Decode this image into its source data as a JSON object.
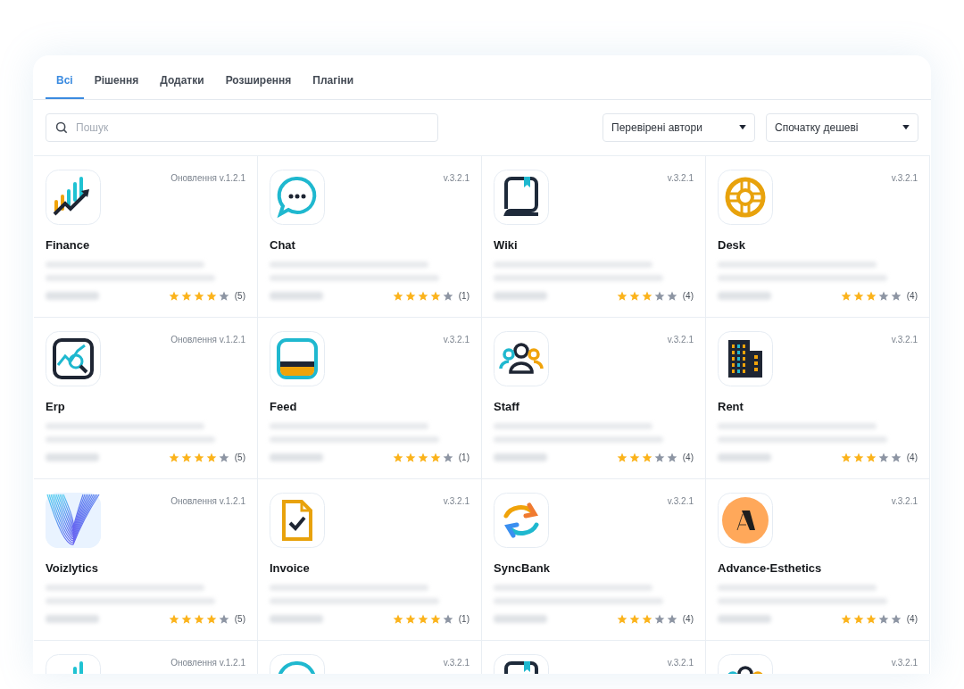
{
  "tabs": [
    {
      "label": "Всі",
      "selected": true
    },
    {
      "label": "Рішення",
      "selected": false
    },
    {
      "label": "Додатки",
      "selected": false
    },
    {
      "label": "Розширення",
      "selected": false
    },
    {
      "label": "Плагіни",
      "selected": false
    }
  ],
  "search": {
    "placeholder": "Пошук"
  },
  "filters": [
    {
      "value": "Перевірені автори"
    },
    {
      "value": "Спочатку дешеві"
    }
  ],
  "apps": [
    {
      "kind": "finance",
      "version": "Оновлення v.1.2.1",
      "name": "Finance",
      "stars": 4,
      "reviews": "(5)"
    },
    {
      "kind": "chat",
      "version": "v.3.2.1",
      "name": "Chat",
      "stars": 4,
      "reviews": "(1)"
    },
    {
      "kind": "wiki",
      "version": "v.3.2.1",
      "name": "Wiki",
      "stars": 3,
      "reviews": "(4)"
    },
    {
      "kind": "desk",
      "version": "v.3.2.1",
      "name": "Desk",
      "stars": 3,
      "reviews": "(4)"
    },
    {
      "kind": "erp",
      "version": "Оновлення v.1.2.1",
      "name": "Erp",
      "stars": 4,
      "reviews": "(5)"
    },
    {
      "kind": "feed",
      "version": "v.3.2.1",
      "name": "Feed",
      "stars": 4,
      "reviews": "(1)"
    },
    {
      "kind": "staff",
      "version": "v.3.2.1",
      "name": "Staff",
      "stars": 3,
      "reviews": "(4)"
    },
    {
      "kind": "rent",
      "version": "v.3.2.1",
      "name": "Rent",
      "stars": 3,
      "reviews": "(4)"
    },
    {
      "kind": "voizlytics",
      "version": "Оновлення v.1.2.1",
      "name": "Voizlytics",
      "stars": 4,
      "reviews": "(5)"
    },
    {
      "kind": "invoice",
      "version": "v.3.2.1",
      "name": "Invoice",
      "stars": 4,
      "reviews": "(1)"
    },
    {
      "kind": "syncbank",
      "version": "v.3.2.1",
      "name": "SyncBank",
      "stars": 3,
      "reviews": "(4)"
    },
    {
      "kind": "advance",
      "version": "v.3.2.1",
      "name": "Advance-Esthetics",
      "stars": 3,
      "reviews": "(4)"
    },
    {
      "kind": "finance",
      "version": "Оновлення v.1.2.1"
    },
    {
      "kind": "chat",
      "version": "v.3.2.1"
    },
    {
      "kind": "wiki",
      "version": "v.3.2.1"
    },
    {
      "kind": "staff",
      "version": "v.3.2.1"
    }
  ]
}
